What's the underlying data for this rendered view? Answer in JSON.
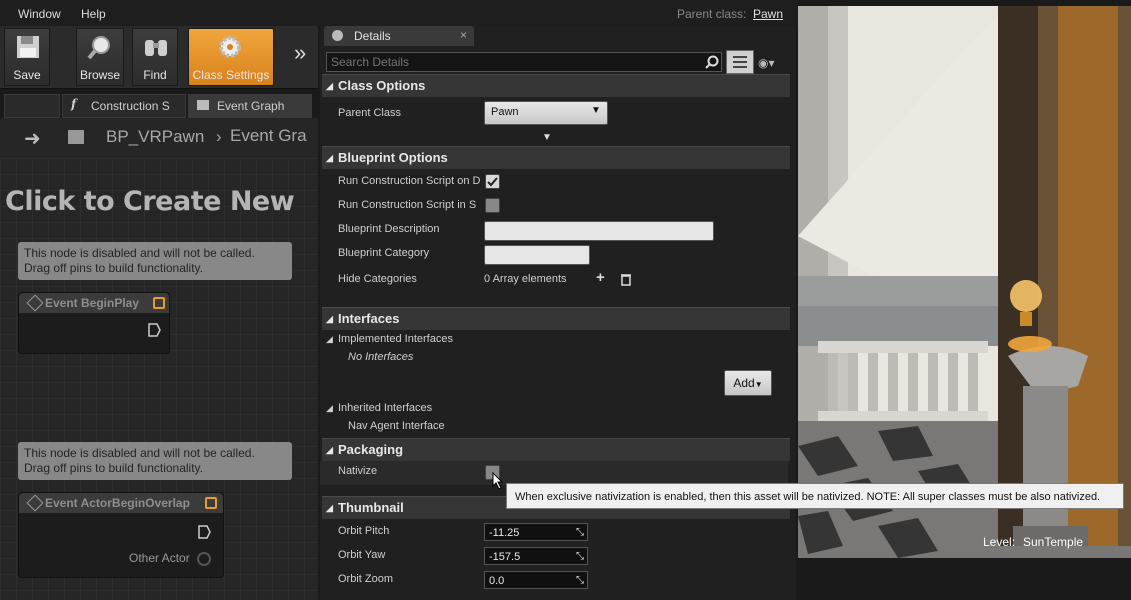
{
  "menu": {
    "window": "Window",
    "help": "Help"
  },
  "parent_class": {
    "label": "Parent class:",
    "value": "Pawn"
  },
  "toolbar": {
    "save": "Save",
    "browse": "Browse",
    "find": "Find",
    "class_settings": "Class Settings",
    "overflow": "»"
  },
  "graph_tabs": {
    "construction": "Construction S",
    "event_graph": "Event Graph"
  },
  "breadcrumb": {
    "blueprint": "BP_VRPawn",
    "graph": "Event Gra"
  },
  "graph": {
    "hint": "Click to Create New",
    "comment_text": "This node is disabled and will not be called.\nDrag off pins to build functionality.",
    "node1": "Event BeginPlay",
    "node2": "Event ActorBeginOverlap",
    "other_actor": "Other Actor"
  },
  "details": {
    "tab": "Details",
    "search_placeholder": "Search Details",
    "class_options": {
      "title": "Class Options",
      "parent_class_label": "Parent Class",
      "parent_class_value": "Pawn"
    },
    "blueprint_options": {
      "title": "Blueprint Options",
      "run_cs_on_drag": "Run Construction Script on D",
      "run_cs_in_seq": "Run Construction Script in S",
      "description": "Blueprint Description",
      "category": "Blueprint Category",
      "hide_categories": "Hide Categories",
      "array_elements": "0 Array elements"
    },
    "interfaces": {
      "title": "Interfaces",
      "implemented": "Implemented Interfaces",
      "none": "No Interfaces",
      "add": "Add",
      "inherited": "Inherited Interfaces",
      "nav_agent": "Nav Agent Interface"
    },
    "packaging": {
      "title": "Packaging",
      "nativize": "Nativize"
    },
    "thumbnail": {
      "title": "Thumbnail",
      "orbit_pitch_label": "Orbit Pitch",
      "orbit_pitch": "-11.25",
      "orbit_yaw_label": "Orbit Yaw",
      "orbit_yaw": "-157.5",
      "orbit_zoom_label": "Orbit Zoom",
      "orbit_zoom": "0.0"
    }
  },
  "tooltip": "When exclusive nativization is enabled, then this asset will be nativized. NOTE: All super classes must be also nativized.",
  "viewport": {
    "level_label": "Level:",
    "level_name": "SunTemple"
  },
  "colors": {
    "accent": "#e89a2e",
    "panel": "#202020",
    "header": "#363636"
  }
}
